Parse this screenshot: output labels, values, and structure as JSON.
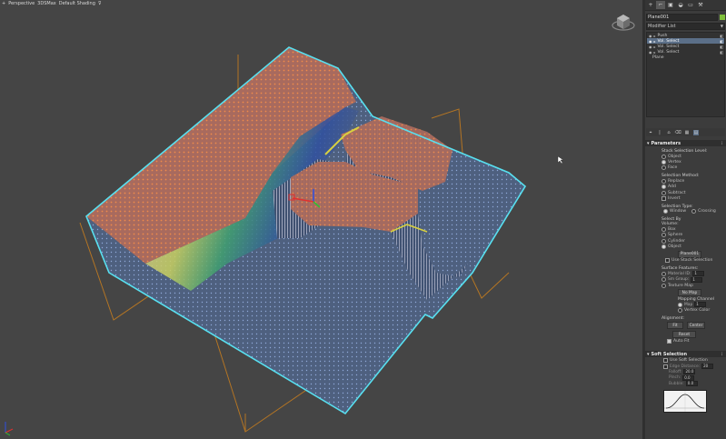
{
  "viewport": {
    "labels": [
      "+",
      "Perspective",
      "3DSMax",
      "Default Shading",
      "⊽"
    ]
  },
  "command_panel": {
    "tabs": [
      "+",
      "⌐",
      "▣",
      "◒",
      "▭",
      "⚒"
    ],
    "object_name": "Plane001",
    "object_color": "#7fc03a",
    "modifier_list": "Modifier List",
    "stack": [
      {
        "label": "Push",
        "selected": false
      },
      {
        "label": "Vol. Select",
        "selected": true
      },
      {
        "label": "Vol. Select",
        "selected": false
      },
      {
        "label": "Vol. Select",
        "selected": false
      },
      {
        "label": "Plane",
        "selected": false
      }
    ],
    "stack_toolbar": [
      "⌖",
      "|",
      "⌂",
      "⌫",
      "▦",
      "▤"
    ],
    "parameters": {
      "title": "Parameters",
      "stack_level_title": "Stack Selection Level:",
      "stack_levels": [
        "Object",
        "Vertex",
        "Face"
      ],
      "method_title": "Selection Method:",
      "methods": [
        "Replace",
        "Add",
        "Subtract",
        "Invert"
      ],
      "type_title": "Selection Type:",
      "types": [
        "Window",
        "Crossing"
      ],
      "select_by_title": "Select By",
      "volume_title": "Volume:",
      "volumes": [
        "Box",
        "Sphere",
        "Cylinder",
        "Object"
      ],
      "object_button": "Plane001",
      "use_stack_selection": "Use Stack Selection",
      "surface_title": "Surface Features:",
      "material_id": "Material ID:",
      "material_id_value": "1",
      "smoothing": "Sm Group:",
      "smoothing_value": "1",
      "texture_map": "Texture Map",
      "no_map": "No Map",
      "mapping_channel": "Mapping Channel",
      "map_label": "Map",
      "map_value": "1",
      "vertex_color": "Vertex Color",
      "alignment_title": "Alignment:",
      "fit_button": "Fit",
      "center_button": "Center",
      "reset_button": "Reset",
      "auto_fit": "Auto Fit"
    },
    "soft_selection": {
      "title": "Soft Selection",
      "use_soft": "Use Soft Selection",
      "edge_distance": "Edge Distance:",
      "edge_distance_value": "20",
      "falloff": "Falloff:",
      "falloff_value": "20.0",
      "pinch": "Pinch:",
      "pinch_value": "0.0",
      "bubble": "Bubble:",
      "bubble_value": "0.0"
    }
  }
}
